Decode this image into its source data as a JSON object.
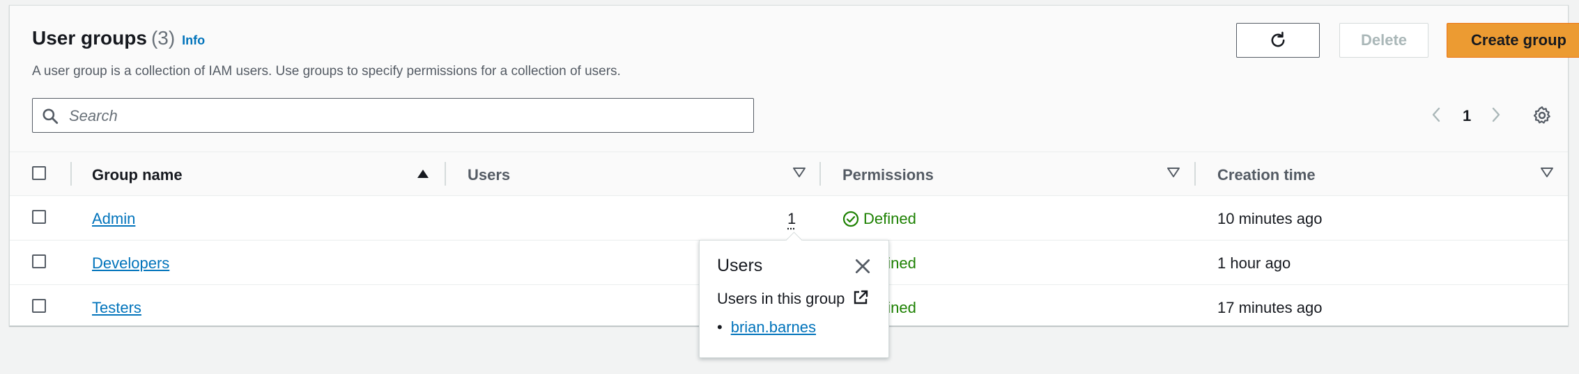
{
  "header": {
    "title": "User groups",
    "count": "(3)",
    "info": "Info",
    "description": "A user group is a collection of IAM users. Use groups to specify permissions for a collection of users.",
    "delete_label": "Delete",
    "create_label": "Create group"
  },
  "search": {
    "placeholder": "Search",
    "value": ""
  },
  "pagination": {
    "current_page": "1"
  },
  "table": {
    "columns": [
      "Group name",
      "Users",
      "Permissions",
      "Creation time"
    ],
    "rows": [
      {
        "name": "Admin",
        "users": "1",
        "permissions": "Defined",
        "created": "10 minutes ago"
      },
      {
        "name": "Developers",
        "users": "",
        "permissions": "Defined",
        "created": "1 hour ago"
      },
      {
        "name": "Testers",
        "users": "",
        "permissions": "Defined",
        "created": "17 minutes ago"
      }
    ]
  },
  "popover": {
    "title": "Users",
    "subtitle": "Users in this group",
    "users": [
      "brian.barnes"
    ]
  },
  "colors": {
    "accent": "#ec9b32",
    "link": "#0073bb",
    "success": "#1d8102"
  }
}
